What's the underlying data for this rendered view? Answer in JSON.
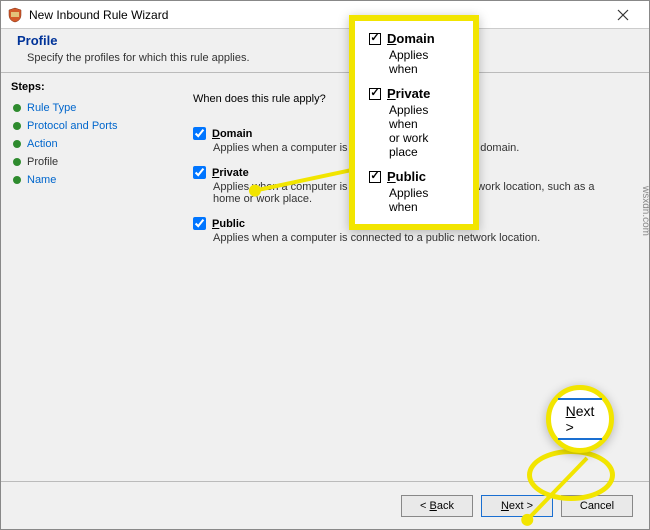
{
  "window": {
    "title": "New Inbound Rule Wizard"
  },
  "header": {
    "title": "Profile",
    "subtitle": "Specify the profiles for which this rule applies."
  },
  "sidebar": {
    "title": "Steps:",
    "items": [
      {
        "label": "Rule Type"
      },
      {
        "label": "Protocol and Ports"
      },
      {
        "label": "Action"
      },
      {
        "label": "Profile"
      },
      {
        "label": "Name"
      }
    ]
  },
  "main": {
    "question": "When does this rule apply?",
    "profiles": [
      {
        "key": "domain",
        "label_underline": "D",
        "label_rest": "omain",
        "desc": "Applies when a computer is connected to its corporate domain."
      },
      {
        "key": "private",
        "label_underline": "P",
        "label_rest": "rivate",
        "desc": "Applies when a computer is connected to a private network location, such as a home or work place."
      },
      {
        "key": "public",
        "label_underline": "P",
        "label_rest": "ublic",
        "desc": "Applies when a computer is connected to a public network location."
      }
    ]
  },
  "overlay": {
    "profiles": [
      {
        "label_underline": "D",
        "label_rest": "omain",
        "desc": "Applies when"
      },
      {
        "label_underline": "P",
        "label_rest": "rivate",
        "desc": "Applies when\nor work place"
      },
      {
        "label_underline": "P",
        "label_rest": "ublic",
        "desc": "Applies when"
      }
    ],
    "next_label_underline": "N",
    "next_label_rest": "ext >"
  },
  "footer": {
    "back_underline": "B",
    "back_rest": "ack",
    "back_prefix": "< ",
    "next_underline": "N",
    "next_rest": "ext >",
    "cancel": "Cancel"
  },
  "watermark": "wsxdn.com"
}
